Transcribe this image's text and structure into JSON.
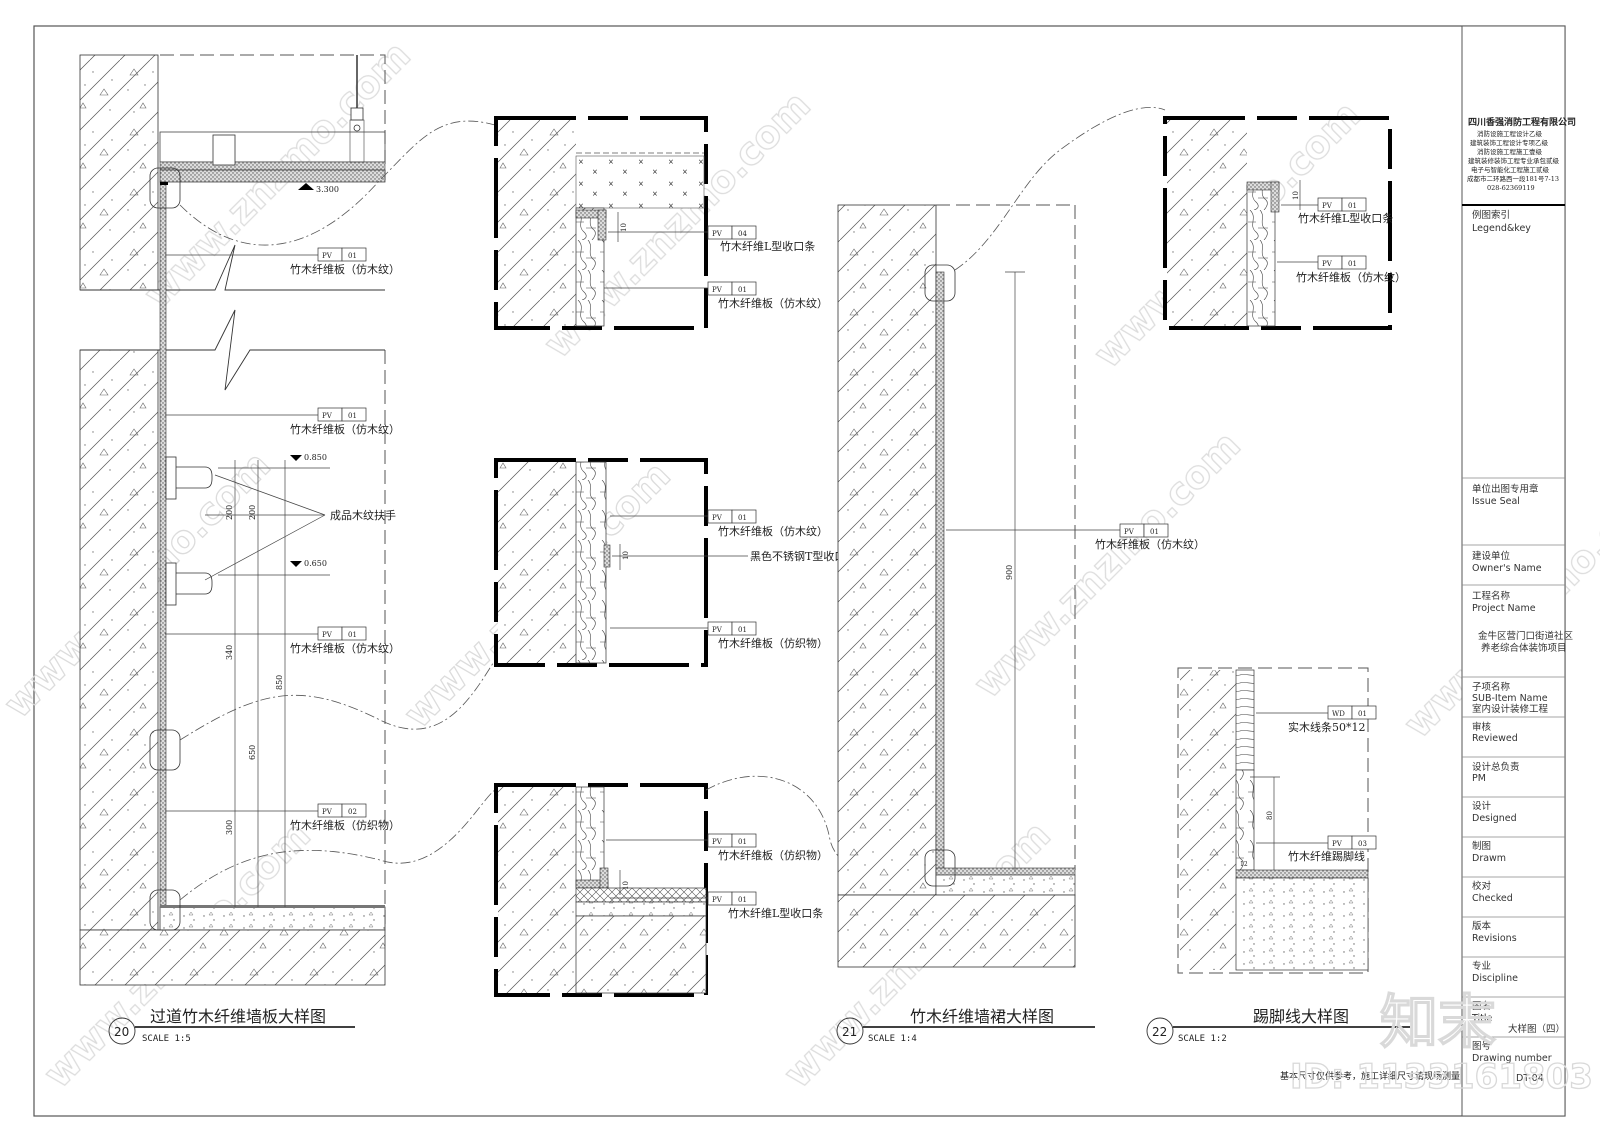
{
  "sheet": {
    "drawing_number": "DT-04",
    "title_partial": "大样图（四）",
    "footer_note": "基本尺寸仅供参考，施工详细尺寸请现场测量"
  },
  "title_block": {
    "company": "四川香强消防工程有限公司",
    "qualifications": [
      "消防设施工程设计乙级",
      "建筑装饰工程设计专项乙级",
      "消防设施工程施工壹级",
      "建筑装修装饰工程专业承包贰级",
      "电子与智能化工程施工贰级",
      "成都市二环路西一段181号7-13",
      "028-62369119"
    ],
    "rows": [
      {
        "cn": "例图索引",
        "en": "Legend&key",
        "value": ""
      },
      {
        "cn": "单位出图专用章",
        "en": "Issue Seal",
        "value": ""
      },
      {
        "cn": "建设单位",
        "en": "Owner's Name",
        "value": ""
      },
      {
        "cn": "工程名称",
        "en": "Project Name",
        "value": "金牛区营门口街道社区\n养老综合体装饰项目"
      },
      {
        "cn": "子项名称",
        "en": "SUB-Item Name",
        "value": "室内设计装修工程"
      },
      {
        "cn": "审核",
        "en": "Reviewed",
        "value": ""
      },
      {
        "cn": "设计总负责",
        "en": "PM",
        "value": ""
      },
      {
        "cn": "设计",
        "en": "Designed",
        "value": ""
      },
      {
        "cn": "制图",
        "en": "Drawm",
        "value": ""
      },
      {
        "cn": "校对",
        "en": "Checked",
        "value": ""
      },
      {
        "cn": "版本",
        "en": "Revisions",
        "value": ""
      },
      {
        "cn": "专业",
        "en": "Discipline",
        "value": ""
      },
      {
        "cn": "图名",
        "en": "Title",
        "value": "大样图（四）"
      },
      {
        "cn": "图号",
        "en": "Drawing number",
        "value": "DT-04"
      }
    ]
  },
  "details": [
    {
      "number": "20",
      "title": "过道竹木纤维墙板大样图",
      "scale": "SCALE 1:5"
    },
    {
      "number": "21",
      "title": "竹木纤维墙裙大样图",
      "scale": "SCALE 1:4"
    },
    {
      "number": "22",
      "title": "踢脚线大样图",
      "scale": "SCALE 1:2"
    }
  ],
  "tags": {
    "pv01_wood": {
      "code": "PV",
      "num": "01",
      "label": "竹木纤维板（仿木纹）"
    },
    "pv02_fabric": {
      "code": "PV",
      "num": "02",
      "label": "竹木纤维板（仿织物）"
    },
    "pv01_fabric": {
      "code": "PV",
      "num": "01",
      "label": "竹木纤维板（仿织物）"
    },
    "pv04_lstrip": {
      "code": "PV",
      "num": "04",
      "label": "竹木纤维L型收口条"
    },
    "pv01_lstrip": {
      "code": "PV",
      "num": "01",
      "label": "竹木纤维L型收口条"
    },
    "tstrip": {
      "label": "黑色不锈钢T型收口条"
    },
    "wd01": {
      "code": "WD",
      "num": "01",
      "label": "实木线条50*12"
    },
    "pv03": {
      "code": "PV",
      "num": "03",
      "label": "竹木纤维踢脚线"
    },
    "handrail": {
      "label": "成品木纹扶手"
    }
  },
  "dimensions": {
    "ceiling_level": "3.300",
    "handrail_top": "0.850",
    "handrail_bottom": "0.650",
    "d200a": "200",
    "d200b": "200",
    "d340": "340",
    "d850": "850",
    "d650": "650",
    "d300": "300",
    "d10": "10",
    "d900": "900",
    "d80": "80",
    "d12": "12"
  },
  "watermark": {
    "site": "www.znzmo.com",
    "brand": "知末",
    "id": "ID: 1133161803"
  }
}
